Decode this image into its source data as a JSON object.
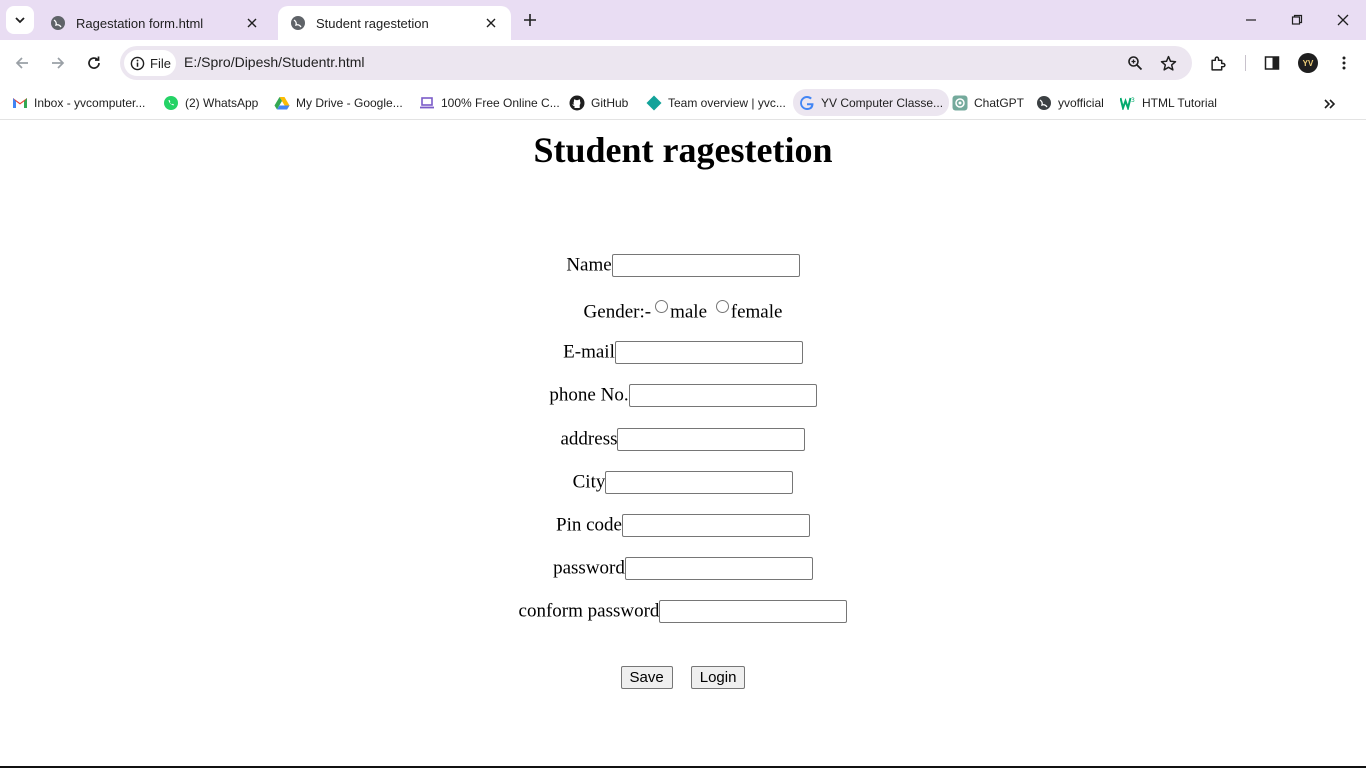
{
  "browser": {
    "tabs": [
      {
        "title": "Ragestation form.html",
        "active": false
      },
      {
        "title": "Student ragestetion",
        "active": true
      }
    ],
    "site_chip": "File",
    "url": "E:/Spro/Dipesh/Studentr.html",
    "avatar_text": "YV",
    "bookmarks": [
      {
        "label": "Inbox - yvcomputer...",
        "icon": "gmail-icon"
      },
      {
        "label": "(2) WhatsApp",
        "icon": "whatsapp-icon"
      },
      {
        "label": "My Drive - Google...",
        "icon": "google-drive-icon"
      },
      {
        "label": "100% Free Online C...",
        "icon": "laptop-icon"
      },
      {
        "label": "GitHub",
        "icon": "github-icon"
      },
      {
        "label": "Team overview | yvc...",
        "icon": "diamond-icon"
      },
      {
        "label": "YV Computer Classe...",
        "icon": "google-icon"
      },
      {
        "label": "ChatGPT",
        "icon": "chatgpt-icon"
      },
      {
        "label": "yvofficial",
        "icon": "globe-icon"
      },
      {
        "label": "HTML Tutorial",
        "icon": "w3schools-icon"
      }
    ]
  },
  "page": {
    "title": "Student ragestetion",
    "form": {
      "name_label": "Name",
      "gender_label": "Gender:-",
      "gender_options": [
        "male",
        "female"
      ],
      "email_label": "E-mail",
      "phone_label": "phone No.",
      "address_label": "address",
      "city_label": "City",
      "pin_label": "Pin code",
      "password_label": "password",
      "confirm_label": "conform password",
      "save_label": "Save",
      "login_label": "Login"
    }
  },
  "colors": {
    "tabstrip_bg": "#e9ddf3",
    "omnibox_bg": "#ece6f0",
    "page_bg": "#ffffff"
  }
}
